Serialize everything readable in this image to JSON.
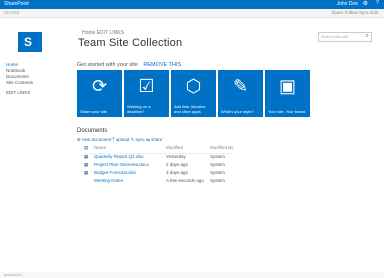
{
  "topbar": {
    "brand": "SharePoint",
    "user": "John Doe",
    "gear": "⚙",
    "help": "?"
  },
  "suitebar": {
    "left": "SHARE",
    "right": "Share  Follow  Sync  Edit"
  },
  "logo": {
    "glyph": "S"
  },
  "breadcrumb": "Home   EDIT LINKS",
  "title": "Team Site Collection",
  "search": {
    "placeholder": "Search this site"
  },
  "quicklaunch": [
    "Home",
    "Notebook",
    "Documents",
    "Site Contents",
    "",
    "EDIT LINKS"
  ],
  "getstarted": {
    "label": "Get started with your site",
    "remove": "REMOVE THIS"
  },
  "tiles": [
    {
      "icon": "⟳",
      "label": "Share your site"
    },
    {
      "icon": "☑",
      "label": "Working on a deadline?"
    },
    {
      "icon": "⬡",
      "label": "Add lists, libraries and other apps"
    },
    {
      "icon": "✎",
      "label": "What's your style?"
    },
    {
      "icon": "▣",
      "label": "Your site. Your brand."
    }
  ],
  "documents": {
    "heading": "Documents",
    "toolbar": "⊕ new document   ⤒ upload   ✎ sync   ⇆ share",
    "columns": {
      "name": "Name",
      "modified": "Modified",
      "by": "Modified By"
    },
    "rows": [
      {
        "icon": "▦",
        "name": "Quarterly Report Q1.xlsx",
        "modified": "Yesterday",
        "by": "System"
      },
      {
        "icon": "▦",
        "name": "Project Plan Overview.docx",
        "modified": "2 days ago",
        "by": "System"
      },
      {
        "icon": "▦",
        "name": "Budget Forecast.xlsx",
        "modified": "3 days ago",
        "by": "System"
      },
      {
        "icon": "",
        "name": "Meeting Notes",
        "modified": "A few seconds ago",
        "by": "System"
      }
    ]
  },
  "bottombar": "javascript:;"
}
